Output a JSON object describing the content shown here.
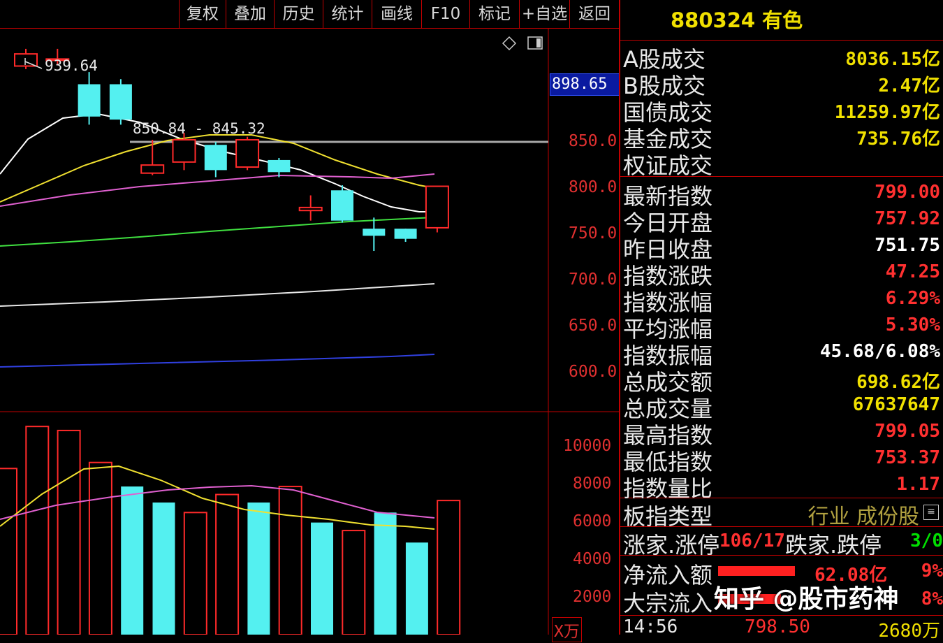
{
  "toolbar": {
    "buttons": [
      "复权",
      "叠加",
      "历史",
      "统计",
      "画线",
      "F10",
      "标记",
      "+自选",
      "返回"
    ]
  },
  "chart": {
    "high_marker": "939.64",
    "range_label": "850.84 - 845.32",
    "current_price_tag": "898.65",
    "price_axis": [
      "850.0",
      "800.0",
      "750.0",
      "700.0",
      "650.0",
      "600.0"
    ],
    "volume_axis": [
      "10000",
      "8000",
      "6000",
      "4000",
      "2000"
    ],
    "volume_unit": "X万",
    "icons": [
      "diamond-icon",
      "panel-toggle-icon"
    ]
  },
  "chart_data": {
    "type": "candlestick",
    "price_ylim": [
      578,
      955
    ],
    "volume_ylim": [
      0,
      11000
    ],
    "candles": [
      {
        "o": 918,
        "c": 930,
        "h": 935,
        "l": 915,
        "up": true
      },
      {
        "o": 925,
        "c": 925,
        "h": 935,
        "l": 920,
        "up": true
      },
      {
        "o": 868,
        "c": 900,
        "h": 912,
        "l": 860,
        "up": false
      },
      {
        "o": 865,
        "c": 900,
        "h": 905,
        "l": 860,
        "up": false
      },
      {
        "o": 812,
        "c": 820,
        "h": 845,
        "l": 810,
        "up": true
      },
      {
        "o": 823,
        "c": 845,
        "h": 852,
        "l": 815,
        "up": true
      },
      {
        "o": 815,
        "c": 840,
        "h": 843,
        "l": 808,
        "up": false
      },
      {
        "o": 818,
        "c": 845,
        "h": 848,
        "l": 815,
        "up": true
      },
      {
        "o": 813,
        "c": 825,
        "h": 827,
        "l": 808,
        "up": false
      },
      {
        "o": 775,
        "c": 778,
        "h": 790,
        "l": 765,
        "up": true
      },
      {
        "o": 765,
        "c": 795,
        "h": 800,
        "l": 763,
        "up": false
      },
      {
        "o": 750,
        "c": 757,
        "h": 768,
        "l": 735,
        "up": false
      },
      {
        "o": 747,
        "c": 757,
        "h": 757,
        "l": 744,
        "up": false
      },
      {
        "o": 757.92,
        "c": 799.0,
        "h": 799.05,
        "l": 753.37,
        "up": true
      }
    ],
    "volumes": [
      8300,
      10400,
      10200,
      8600,
      7400,
      6600,
      6100,
      7000,
      6600,
      7400,
      5600,
      5200,
      6100,
      4600,
      6700
    ]
  },
  "panel": {
    "title": "880324 有色",
    "rows": [
      {
        "label": "A股成交",
        "value": "8036.15亿",
        "color": "#f0e000"
      },
      {
        "label": "B股成交",
        "value": "2.47亿",
        "color": "#f0e000"
      },
      {
        "label": "国债成交",
        "value": "11259.97亿",
        "color": "#f0e000"
      },
      {
        "label": "基金成交",
        "value": "735.76亿",
        "color": "#f0e000"
      },
      {
        "label": "权证成交",
        "value": "",
        "color": "#f0e000"
      },
      {
        "label": "最新指数",
        "value": "799.00",
        "color": "#ff3030"
      },
      {
        "label": "今日开盘",
        "value": "757.92",
        "color": "#ff3030"
      },
      {
        "label": "昨日收盘",
        "value": "751.75",
        "color": "#ffffff"
      },
      {
        "label": "指数涨跌",
        "value": "47.25",
        "color": "#ff3030"
      },
      {
        "label": "指数涨幅",
        "value": "6.29%",
        "color": "#ff3030"
      },
      {
        "label": "平均涨幅",
        "value": "5.30%",
        "color": "#ff3030"
      },
      {
        "label": "指数振幅",
        "value": "45.68/6.08%",
        "color": "#ffffff"
      },
      {
        "label": "总成交额",
        "value": "698.62亿",
        "color": "#f0e000"
      },
      {
        "label": "总成交量",
        "value": "67637647",
        "color": "#f0e000"
      },
      {
        "label": "最高指数",
        "value": "799.05",
        "color": "#ff3030"
      },
      {
        "label": "最低指数",
        "value": "753.37",
        "color": "#ff3030"
      },
      {
        "label": "指数量比",
        "value": "1.17",
        "color": "#ff3030"
      }
    ],
    "sector_type": {
      "label": "板指类型",
      "value": "行业 成份股"
    },
    "breadth": {
      "up_label": "涨家.涨停",
      "up_value": "106/17",
      "down_label": "跌家.跌停",
      "down_value": "3/0"
    },
    "net_flow": {
      "label": "净流入额",
      "value": "62.08亿",
      "pct": "9%"
    },
    "block_flow": {
      "label": "大宗流入",
      "pct": "8%"
    },
    "tick": {
      "time": "14:56",
      "price": "798.50",
      "vol": "2680万"
    }
  },
  "watermark": "知乎 @股市药神"
}
